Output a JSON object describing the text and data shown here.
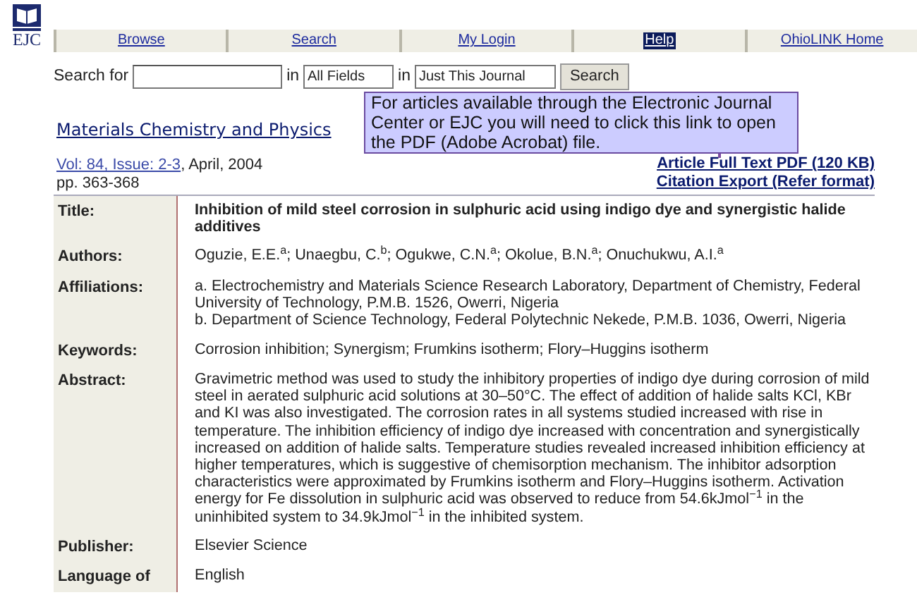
{
  "logo": {
    "text": "EJC"
  },
  "nav": [
    {
      "label": "Browse",
      "selected": false
    },
    {
      "label": "Search",
      "selected": false
    },
    {
      "label": "My Login",
      "selected": false
    },
    {
      "label": "Help",
      "selected": true
    },
    {
      "label": "OhioLINK Home",
      "selected": false
    }
  ],
  "search": {
    "label": "Search for",
    "in_1": "in",
    "field": "All Fields",
    "in_2": "in",
    "scope": "Just This Journal",
    "button": "Search"
  },
  "tooltip": "For articles available through the Electronic Journal Center or EJC you will need to click this link to open the PDF (Adobe Acrobat) file.",
  "journal": "Materials Chemistry and Physics",
  "issue_link": "Vol: 84, Issue: 2-3",
  "issue_date": ", April, 2004",
  "pages": "pp. 363-368",
  "links": [
    "Article Full Text PDF (120 KB)",
    "Citation Export (Refer format)"
  ],
  "fields": [
    {
      "label": "Title:",
      "kind": "bold",
      "value": [
        "Inhibition of mild steel corrosion in sulphuric acid using indigo dye and synergistic halide additives"
      ]
    },
    {
      "label": "Authors:",
      "kind": "plain",
      "value": [
        "Oguzie, E.E.$^{a}$; Unaegbu, C.$^{b}$; Ogukwe, C.N.$^{a}$; Okolue, B.N.$^{a}$; Onuchukwu, A.I.$^{a}$"
      ]
    },
    {
      "label": "Affiliations:",
      "kind": "plain",
      "value": [
        "a. Electrochemistry and Materials Science Research Laboratory, Department of Chemistry, Federal University of Technology, P.M.B. 1526, Owerri, Nigeria",
        "b. Department of Science Technology, Federal Polytechnic Nekede, P.M.B. 1036, Owerri, Nigeria"
      ]
    },
    {
      "label": "Keywords:",
      "kind": "plain",
      "value": [
        "Corrosion inhibition; Synergism; Frumkins isotherm; Flory–Huggins isotherm"
      ]
    },
    {
      "label": "Abstract:",
      "kind": "plain",
      "value": [
        "Gravimetric method was used to study the inhibitory properties of indigo dye during corrosion of mild steel in aerated sulphuric acid solutions at 30–50°C. The effect of addition of halide salts KCl, KBr and KI was also investigated. The corrosion rates in all systems studied increased with rise in temperature. The inhibition efficiency of indigo dye increased with concentration and synergistically increased on addition of halide salts. Temperature studies revealed increased inhibition efficiency at higher temperatures, which is suggestive of chemisorption mechanism. The inhibitor adsorption characteristics were approximated by Frumkins isotherm and Flory–Huggins isotherm. Activation energy for Fe dissolution in sulphuric acid was observed to reduce from 54.6kJmol$^{−1}$ in the uninhibited system to 34.9kJmol$^{−1}$ in the inhibited system."
      ]
    },
    {
      "label": "Publisher:",
      "kind": "plain",
      "value": [
        "Elsevier Science"
      ]
    },
    {
      "label": "Language of",
      "kind": "plain",
      "value": [
        "English"
      ]
    }
  ]
}
